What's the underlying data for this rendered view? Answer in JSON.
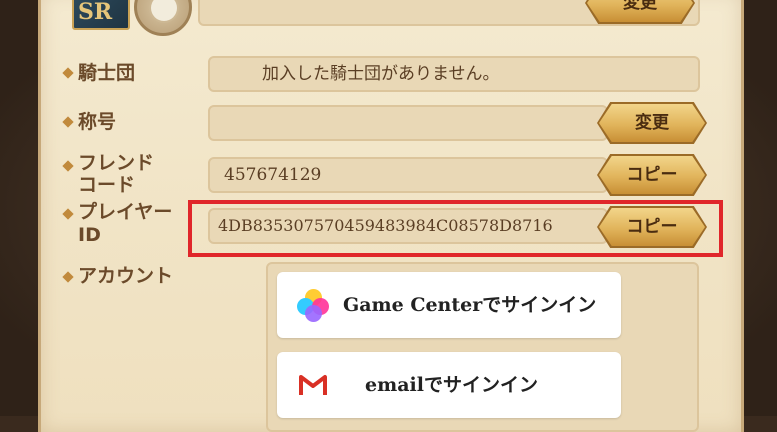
{
  "profile": {
    "rank_badge": "SR",
    "change_button_top": "変更"
  },
  "rows": {
    "guild": {
      "label": "騎士団",
      "value": "加入した騎士団がありません。"
    },
    "title": {
      "label": "称号",
      "value": "",
      "button": "変更"
    },
    "friend_code": {
      "label_line1": "フレンド",
      "label_line2": "コード",
      "value": "457674129",
      "button": "コピー"
    },
    "player_id": {
      "label_line1": "プレイヤー",
      "label_line2": "ID",
      "value": "4DB83530757045948398​4C08578D8716",
      "button": "コピー"
    },
    "account": {
      "label": "アカウント"
    }
  },
  "signin": {
    "game_center": "Game Centerでサインイン",
    "email": "emailでサインイン"
  },
  "colors": {
    "highlight": "#e0262a",
    "button_gold": "#e1b45b",
    "label_brown": "#6b4a2a"
  }
}
